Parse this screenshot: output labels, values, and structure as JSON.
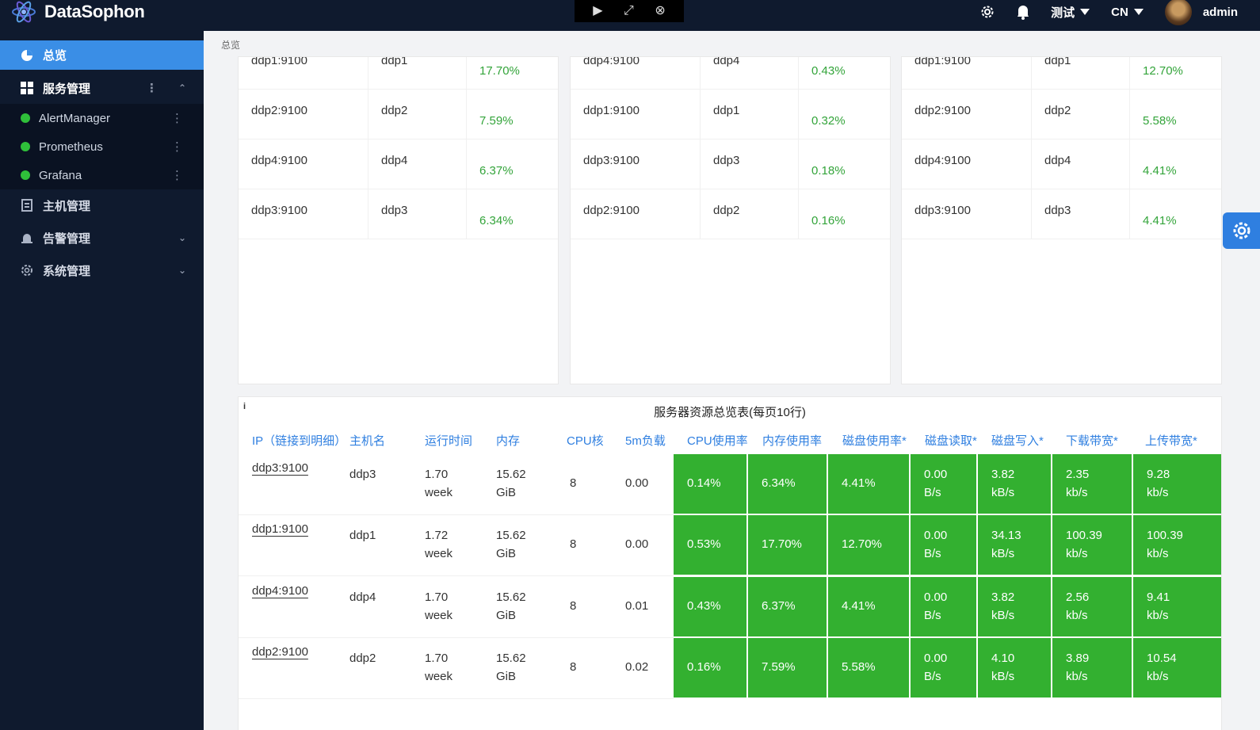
{
  "app": {
    "name": "DataSophon",
    "screen_toolbar": [
      "▶",
      "⤢",
      "⊗"
    ],
    "header": {
      "settings_icon": "gear-icon",
      "bell_icon": "bell-icon",
      "cluster": "测试",
      "lang": "CN",
      "user": "admin"
    }
  },
  "sidebar": {
    "active": "总览",
    "group": "服务管理",
    "services": [
      {
        "label": "AlertManager",
        "status_color": "#2fbf3a"
      },
      {
        "label": "Prometheus",
        "status_color": "#2fbf3a"
      },
      {
        "label": "Grafana",
        "status_color": "#2fbf3a"
      }
    ],
    "host_mgmt": "主机管理",
    "alert_mgmt": "告警管理",
    "system_mgmt": "系统管理"
  },
  "breadcrumb": "总览",
  "top_cards": [
    {
      "partial": {
        "ip": "ddp1:9100",
        "host": "ddp1",
        "value": "17.70%"
      },
      "rows": [
        {
          "ip": "ddp2:9100",
          "host": "ddp2",
          "value": "7.59%"
        },
        {
          "ip": "ddp4:9100",
          "host": "ddp4",
          "value": "6.37%"
        },
        {
          "ip": "ddp3:9100",
          "host": "ddp3",
          "value": "6.34%"
        }
      ]
    },
    {
      "partial": {
        "ip": "ddp4:9100",
        "host": "ddp4",
        "value": "0.43%"
      },
      "rows": [
        {
          "ip": "ddp1:9100",
          "host": "ddp1",
          "value": "0.32%"
        },
        {
          "ip": "ddp3:9100",
          "host": "ddp3",
          "value": "0.18%"
        },
        {
          "ip": "ddp2:9100",
          "host": "ddp2",
          "value": "0.16%"
        }
      ]
    },
    {
      "partial": {
        "ip": "ddp1:9100",
        "host": "ddp1",
        "value": "12.70%"
      },
      "rows": [
        {
          "ip": "ddp2:9100",
          "host": "ddp2",
          "value": "5.58%"
        },
        {
          "ip": "ddp4:9100",
          "host": "ddp4",
          "value": "4.41%"
        },
        {
          "ip": "ddp3:9100",
          "host": "ddp3",
          "value": "4.41%"
        }
      ]
    }
  ],
  "resource_table": {
    "info": "i",
    "title": "服务器资源总览表(每页10行)",
    "headers": [
      "IP（链接到明细）",
      "主机名",
      "运行时间",
      "内存",
      "CPU核",
      "5m负载",
      "CPU使用率",
      "内存使用率",
      "磁盘使用率*",
      "磁盘读取*",
      "磁盘写入*",
      "下载带宽*",
      "上传带宽*"
    ],
    "rows": [
      {
        "ip": "ddp3:9100",
        "host": "ddp3",
        "uptime": [
          "1.70",
          "week"
        ],
        "mem": [
          "15.62",
          "GiB"
        ],
        "cpu": "8",
        "load": "0.00",
        "cpu_use": "0.14%",
        "mem_use": "6.34%",
        "disk_use": "4.41%",
        "disk_read": [
          "0.00",
          "B/s"
        ],
        "disk_write": [
          "3.82",
          "kB/s"
        ],
        "down": [
          "2.35",
          "kb/s"
        ],
        "up": [
          "9.28",
          "kb/s"
        ]
      },
      {
        "ip": "ddp1:9100",
        "host": "ddp1",
        "uptime": [
          "1.72",
          "week"
        ],
        "mem": [
          "15.62",
          "GiB"
        ],
        "cpu": "8",
        "load": "0.00",
        "cpu_use": "0.53%",
        "mem_use": "17.70%",
        "disk_use": "12.70%",
        "disk_read": [
          "0.00",
          "B/s"
        ],
        "disk_write": [
          "34.13",
          "kB/s"
        ],
        "down": [
          "100.39",
          "kb/s"
        ],
        "up": [
          "100.39",
          "kb/s"
        ]
      },
      {
        "ip": "ddp4:9100",
        "host": "ddp4",
        "uptime": [
          "1.70",
          "week"
        ],
        "mem": [
          "15.62",
          "GiB"
        ],
        "cpu": "8",
        "load": "0.01",
        "cpu_use": "0.43%",
        "mem_use": "6.37%",
        "disk_use": "4.41%",
        "disk_read": [
          "0.00",
          "B/s"
        ],
        "disk_write": [
          "3.82",
          "kB/s"
        ],
        "down": [
          "2.56",
          "kb/s"
        ],
        "up": [
          "9.41",
          "kb/s"
        ]
      },
      {
        "ip": "ddp2:9100",
        "host": "ddp2",
        "uptime": [
          "1.70",
          "week"
        ],
        "mem": [
          "15.62",
          "GiB"
        ],
        "cpu": "8",
        "load": "0.02",
        "cpu_use": "0.16%",
        "mem_use": "7.59%",
        "disk_use": "5.58%",
        "disk_read": [
          "0.00",
          "B/s"
        ],
        "disk_write": [
          "4.10",
          "kB/s"
        ],
        "down": [
          "3.89",
          "kb/s"
        ],
        "up": [
          "10.54",
          "kb/s"
        ]
      }
    ]
  }
}
